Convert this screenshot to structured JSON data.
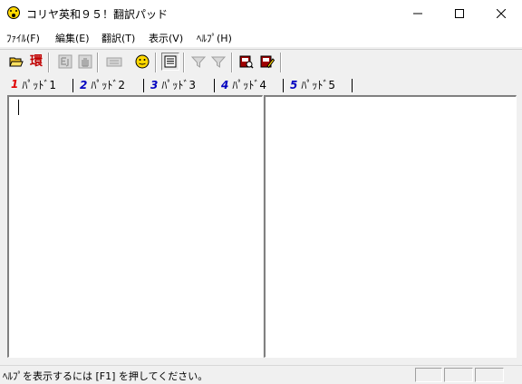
{
  "window": {
    "title": "コリヤ英和９５！翻訳パッド",
    "min_icon": "minimize-icon",
    "max_icon": "maximize-icon",
    "close_icon": "close-icon"
  },
  "menu": [
    {
      "label": "ﾌｧｲﾙ(F)"
    },
    {
      "label": "編集(E)"
    },
    {
      "label": "翻訳(T)"
    },
    {
      "label": "表示(V)"
    },
    {
      "label": "ﾍﾙﾌﾟ(H)"
    }
  ],
  "toolbar": {
    "env_label": "環",
    "icons": [
      "open-folder-icon",
      "environment-icon",
      "ej-translate-icon",
      "hand-icon",
      "keyboard-icon",
      "smiley-icon",
      "document-view-icon",
      "filter-icon",
      "filter-down-icon",
      "dictionary-icon",
      "edit-dictionary-icon"
    ]
  },
  "tabs": [
    {
      "num": "1",
      "label": "ﾊﾟｯﾄﾞ1",
      "color": "#e00000"
    },
    {
      "num": "2",
      "label": "ﾊﾟｯﾄﾞ2",
      "color": "#0000c0"
    },
    {
      "num": "3",
      "label": "ﾊﾟｯﾄﾞ3",
      "color": "#0000c0"
    },
    {
      "num": "4",
      "label": "ﾊﾟｯﾄﾞ4",
      "color": "#0000c0"
    },
    {
      "num": "5",
      "label": "ﾊﾟｯﾄﾞ5",
      "color": "#0000c0"
    }
  ],
  "statusbar": {
    "text": "ﾍﾙﾌﾟを表示するには [F1] を押してください。"
  }
}
